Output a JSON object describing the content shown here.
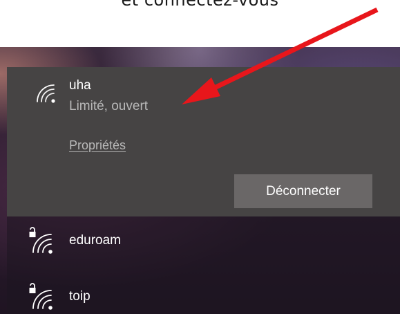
{
  "caption": {
    "text": "et connectez-vous"
  },
  "active_network": {
    "name": "uha",
    "status": "Limité, ouvert",
    "properties_link": "Propriétés",
    "disconnect_button": "Déconnecter",
    "icon": "wifi-icon"
  },
  "networks": [
    {
      "name": "eduroam",
      "icon": "wifi-secured-icon"
    },
    {
      "name": "toip",
      "icon": "wifi-secured-icon"
    }
  ],
  "annotation": {
    "arrow_color": "#e8161b"
  }
}
